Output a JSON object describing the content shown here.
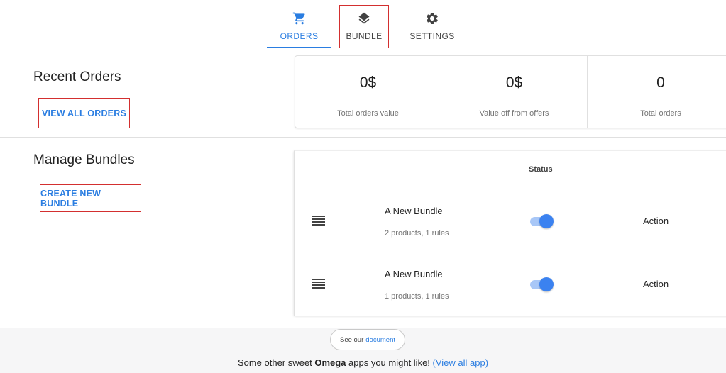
{
  "tabs": [
    {
      "label": "ORDERS",
      "icon": "cart-icon",
      "active": true
    },
    {
      "label": "BUNDLE",
      "icon": "layers-icon",
      "active": false
    },
    {
      "label": "SETTINGS",
      "icon": "gear-icon",
      "active": false
    }
  ],
  "recent_orders": {
    "title": "Recent Orders",
    "view_all_label": "VIEW ALL ORDERS"
  },
  "stats": [
    {
      "value": "0$",
      "label": "Total orders value"
    },
    {
      "value": "0$",
      "label": "Value off from offers"
    },
    {
      "value": "0",
      "label": "Total orders"
    }
  ],
  "manage_bundles": {
    "title": "Manage Bundles",
    "create_label": "CREATE NEW BUNDLE",
    "status_header": "Status",
    "rows": [
      {
        "name": "A New Bundle",
        "meta": "2 products, 1 rules",
        "enabled": true,
        "action": "Action"
      },
      {
        "name": "A New Bundle",
        "meta": "1 products, 1 rules",
        "enabled": true,
        "action": "Action"
      }
    ]
  },
  "footer": {
    "see_our": "See our",
    "document_link": "document",
    "promo_prefix": "Some other sweet ",
    "promo_brand": "Omega",
    "promo_suffix": " apps you might like! ",
    "view_all_link": "(View all app)"
  },
  "colors": {
    "accent": "#2a7de1",
    "highlight_border": "#d32f2f",
    "toggle_on": "#3b82f0"
  }
}
